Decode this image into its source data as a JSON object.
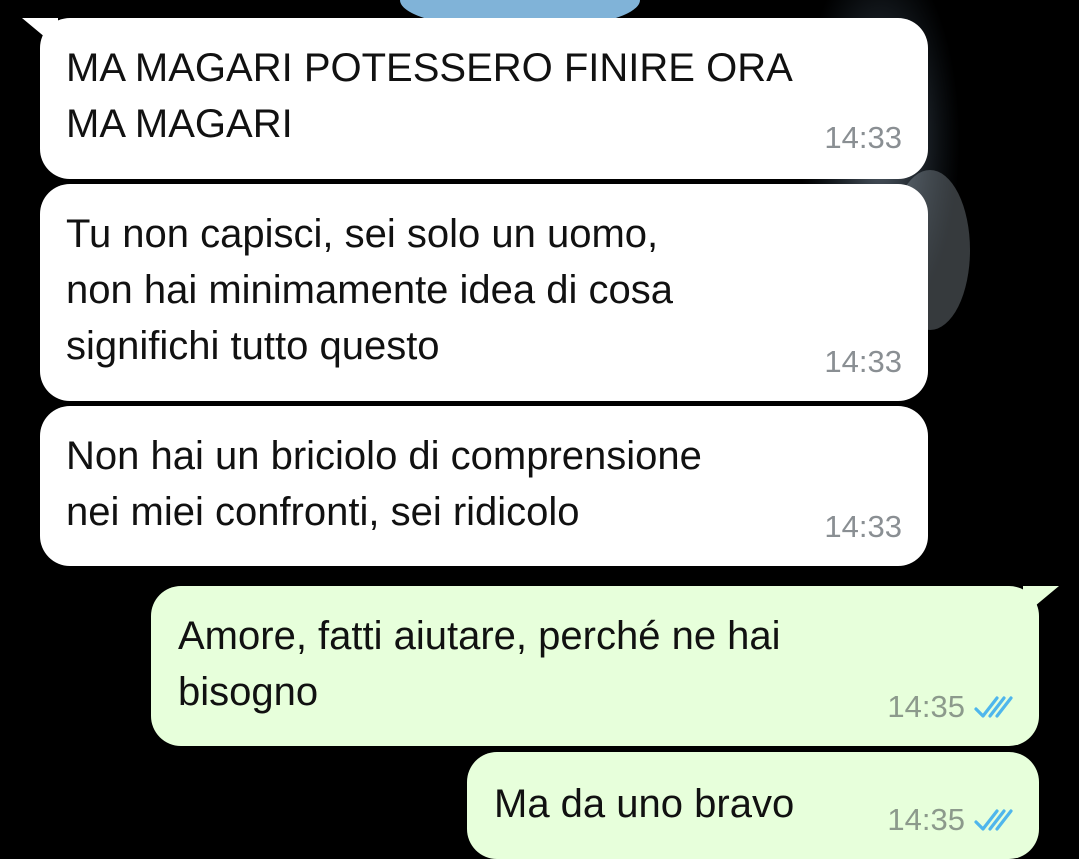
{
  "messages": [
    {
      "direction": "incoming",
      "text": "MA MAGARI POTESSERO FINIRE ORA\nMA MAGARI",
      "time": "14:33"
    },
    {
      "direction": "incoming",
      "text": "Tu non capisci, sei solo un uomo,\nnon hai minimamente idea di cosa\nsignifichi tutto questo",
      "time": "14:33"
    },
    {
      "direction": "incoming",
      "text": "Non hai un briciolo di comprensione\nnei miei confronti, sei ridicolo",
      "time": "14:33"
    },
    {
      "direction": "outgoing",
      "text": "Amore, fatti aiutare, perché ne hai\nbisogno",
      "time": "14:35",
      "status_icon": "double-check-read-icon"
    },
    {
      "direction": "outgoing",
      "text": "Ma da uno bravo",
      "time": "14:35",
      "status_icon": "double-check-read-icon"
    }
  ],
  "colors": {
    "background": "#000000",
    "incoming_bubble": "#ffffff",
    "outgoing_bubble": "#e7ffdb",
    "read_ticks": "#4fb6ec"
  }
}
